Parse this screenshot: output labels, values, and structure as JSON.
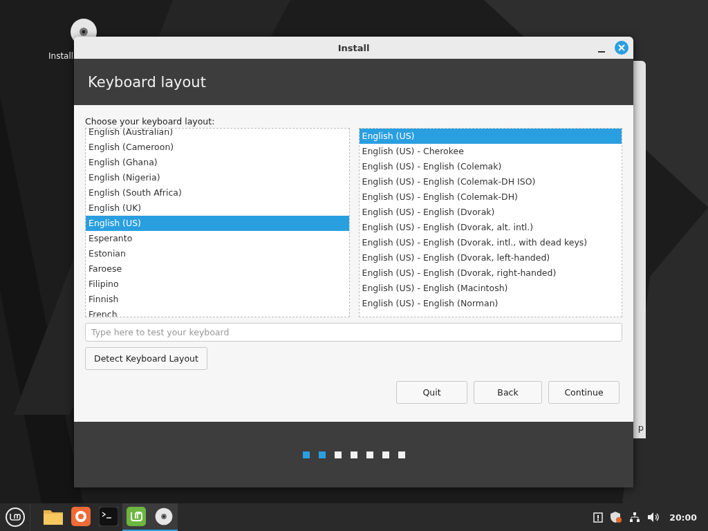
{
  "desktop_icon": {
    "label": "Install"
  },
  "background_window": {
    "text": "p"
  },
  "window": {
    "title": "Install",
    "heading": "Keyboard layout",
    "prompt": "Choose your keyboard layout:"
  },
  "layouts": [
    {
      "label": "English (Australian)",
      "selected": false
    },
    {
      "label": "English (Cameroon)",
      "selected": false
    },
    {
      "label": "English (Ghana)",
      "selected": false
    },
    {
      "label": "English (Nigeria)",
      "selected": false
    },
    {
      "label": "English (South Africa)",
      "selected": false
    },
    {
      "label": "English (UK)",
      "selected": false
    },
    {
      "label": "English (US)",
      "selected": true
    },
    {
      "label": "Esperanto",
      "selected": false
    },
    {
      "label": "Estonian",
      "selected": false
    },
    {
      "label": "Faroese",
      "selected": false
    },
    {
      "label": "Filipino",
      "selected": false
    },
    {
      "label": "Finnish",
      "selected": false
    },
    {
      "label": "French",
      "selected": false
    }
  ],
  "variants": [
    {
      "label": "English (US)",
      "selected": true
    },
    {
      "label": "English (US) - Cherokee",
      "selected": false
    },
    {
      "label": "English (US) - English (Colemak)",
      "selected": false
    },
    {
      "label": "English (US) - English (Colemak-DH ISO)",
      "selected": false
    },
    {
      "label": "English (US) - English (Colemak-DH)",
      "selected": false
    },
    {
      "label": "English (US) - English (Dvorak)",
      "selected": false
    },
    {
      "label": "English (US) - English (Dvorak, alt. intl.)",
      "selected": false
    },
    {
      "label": "English (US) - English (Dvorak, intl., with dead keys)",
      "selected": false
    },
    {
      "label": "English (US) - English (Dvorak, left-handed)",
      "selected": false
    },
    {
      "label": "English (US) - English (Dvorak, right-handed)",
      "selected": false
    },
    {
      "label": "English (US) - English (Macintosh)",
      "selected": false
    },
    {
      "label": "English (US) - English (Norman)",
      "selected": false
    }
  ],
  "test_field": {
    "placeholder": "Type here to test your keyboard"
  },
  "detect_button": "Detect Keyboard Layout",
  "buttons": [
    "Quit",
    "Back",
    "Continue"
  ],
  "steps": [
    {
      "completed": true
    },
    {
      "completed": true
    },
    {
      "completed": false
    },
    {
      "completed": false
    },
    {
      "completed": false
    },
    {
      "completed": false
    },
    {
      "completed": false
    }
  ],
  "taskbar": {
    "apps": [
      {
        "kind": "folder",
        "active": false
      },
      {
        "kind": "browser",
        "active": false
      },
      {
        "kind": "terminal",
        "active": false
      },
      {
        "kind": "mint",
        "active": true
      },
      {
        "kind": "disc",
        "active": true
      }
    ],
    "clock": "20:00"
  }
}
